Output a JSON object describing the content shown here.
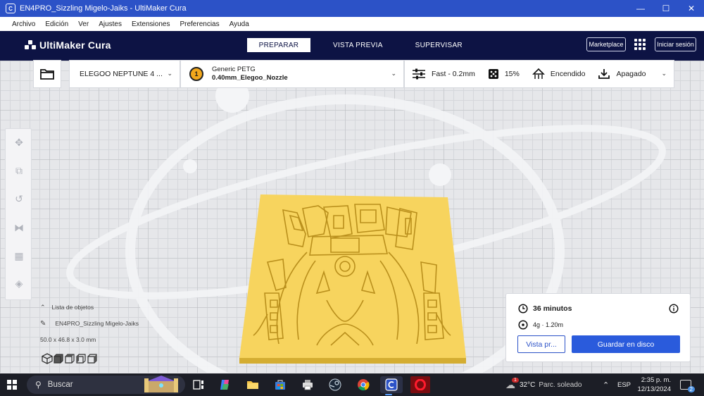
{
  "window": {
    "title": "EN4PRO_Sizzling Migelo-Jaiks - UltiMaker Cura",
    "minimize": "—",
    "maximize": "☐",
    "close": "✕"
  },
  "menu": [
    "Archivo",
    "Edición",
    "Ver",
    "Ajustes",
    "Extensiones",
    "Preferencias",
    "Ayuda"
  ],
  "header": {
    "logo": "UltiMaker Cura",
    "tabs": [
      {
        "label": "PREPARAR",
        "active": true
      },
      {
        "label": "VISTA PREVIA",
        "active": false
      },
      {
        "label": "SUPERVISAR",
        "active": false
      }
    ],
    "marketplace": "Marketplace",
    "signin": "Iniciar sesión"
  },
  "setup": {
    "printer": "ELEGOO NEPTUNE 4 ...",
    "extruder_number": "1",
    "material": "Generic PETG",
    "nozzle": "0.40mm_Elegoo_Nozzle",
    "profile": "Fast - 0.2mm",
    "infill": "15%",
    "support": "Encendido",
    "adhesion": "Apagado"
  },
  "objects": {
    "header": "Lista de objetos",
    "name": "EN4PRO_Sizzling Migelo-Jaiks",
    "dimensions": "50.0 x 46.8 x 3.0 mm"
  },
  "print": {
    "time": "36 minutos",
    "material": "4g · 1.20m",
    "preview_button": "Vista pr...",
    "save_button": "Guardar en disco"
  },
  "taskbar": {
    "search": "Buscar",
    "temperature": "32°C",
    "weather": "Parc. soleado",
    "weather_badge": "1",
    "language": "ESP",
    "time": "2:35 p. m.",
    "date": "12/13/2024",
    "notifications": "2"
  },
  "colors": {
    "titlebar": "#2c52c7",
    "header": "#0d1344",
    "accent": "#2a5bdc",
    "model": "#f9d45c",
    "extruder": "#f2a71b"
  }
}
